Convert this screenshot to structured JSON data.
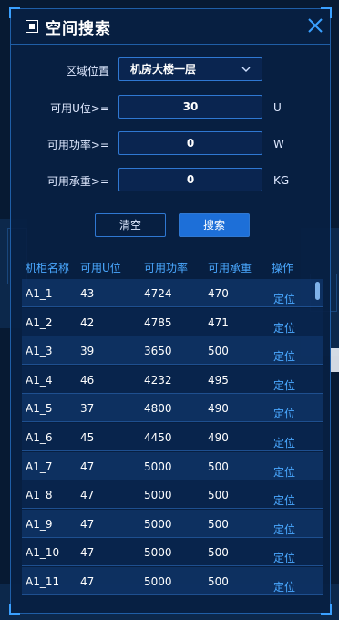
{
  "panel": {
    "title": "空间搜索"
  },
  "form": {
    "area_label": "区域位置",
    "area_value": "机房大楼一层",
    "u_label": "可用U位>=",
    "u_value": "30",
    "u_unit": "U",
    "power_label": "可用功率>=",
    "power_value": "0",
    "power_unit": "W",
    "load_label": "可用承重>=",
    "load_value": "0",
    "load_unit": "KG"
  },
  "buttons": {
    "clear": "清空",
    "search": "搜索"
  },
  "table": {
    "headers": [
      "机柜名称",
      "可用U位",
      "可用功率",
      "可用承重",
      "操作"
    ],
    "rows": [
      {
        "name": "A1_1",
        "u": "43",
        "power": "4724",
        "load": "470",
        "action": "定位"
      },
      {
        "name": "A1_2",
        "u": "42",
        "power": "4785",
        "load": "471",
        "action": "定位"
      },
      {
        "name": "A1_3",
        "u": "39",
        "power": "3650",
        "load": "500",
        "action": "定位"
      },
      {
        "name": "A1_4",
        "u": "46",
        "power": "4232",
        "load": "495",
        "action": "定位"
      },
      {
        "name": "A1_5",
        "u": "37",
        "power": "4800",
        "load": "490",
        "action": "定位"
      },
      {
        "name": "A1_6",
        "u": "45",
        "power": "4450",
        "load": "490",
        "action": "定位"
      },
      {
        "name": "A1_7",
        "u": "47",
        "power": "5000",
        "load": "500",
        "action": "定位"
      },
      {
        "name": "A1_8",
        "u": "47",
        "power": "5000",
        "load": "500",
        "action": "定位"
      },
      {
        "name": "A1_9",
        "u": "47",
        "power": "5000",
        "load": "500",
        "action": "定位"
      },
      {
        "name": "A1_10",
        "u": "47",
        "power": "5000",
        "load": "500",
        "action": "定位"
      },
      {
        "name": "A1_11",
        "u": "47",
        "power": "5000",
        "load": "500",
        "action": "定位"
      }
    ]
  },
  "colors": {
    "accent": "#1d6fd8",
    "link": "#4aa8ff",
    "border": "#2f78d2"
  }
}
